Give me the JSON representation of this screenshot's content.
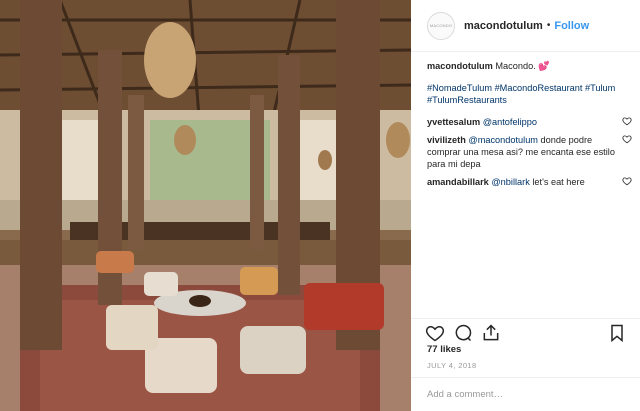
{
  "post": {
    "photo_label": "Restaurant interior with wooden pillars, woven pendant lamps, poufs and rugs",
    "avatar_text": "MACONDO",
    "username": "macondotulum",
    "separator": "•",
    "follow_label": "Follow"
  },
  "caption": {
    "user": "macondotulum",
    "text": "Macondo. 💕",
    "hashtags": "#NomadeTulum #MacondoRestaurant #Tulum #TulumRestaurants"
  },
  "comments": [
    {
      "user": "yvettesalum",
      "mention": "@antofelippo",
      "text": ""
    },
    {
      "user": "vivilizeth",
      "mention": "@macondotulum",
      "text": "donde podre comprar una mesa asi? me encanta ese estilo para mi depa"
    },
    {
      "user": "amandabillark",
      "mention": "@nbillark",
      "text": "let's eat here"
    }
  ],
  "actions": {
    "likes": "77 likes",
    "date": "JULY 4, 2018",
    "comment_placeholder": "Add a comment…"
  },
  "icons": {
    "heart": "heart-icon",
    "comment": "comment-icon",
    "share": "share-icon",
    "save": "bookmark-icon"
  }
}
